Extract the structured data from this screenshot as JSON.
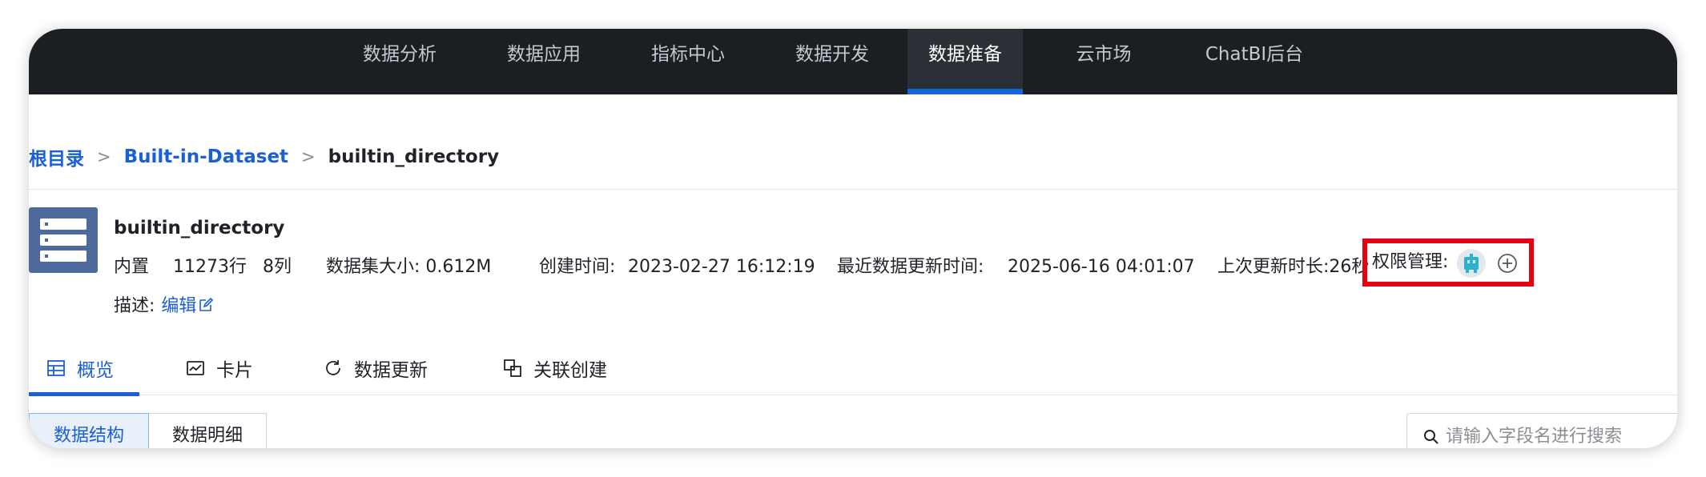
{
  "nav": {
    "items": [
      "数据分析",
      "数据应用",
      "指标中心",
      "数据开发",
      "数据准备",
      "云市场",
      "ChatBI后台"
    ],
    "active_index": 4
  },
  "breadcrumb": {
    "root": "根目录",
    "parent": "Built-in-Dataset",
    "current": "builtin_directory",
    "separator": ">"
  },
  "dataset": {
    "name": "builtin_directory",
    "type": "内置",
    "rows": "11273行",
    "columns": "8列",
    "size": "数据集大小: 0.612M",
    "created_label": "创建时间:",
    "created_value": "2023-02-27 16:12:19",
    "updated_label": "最近数据更新时间:",
    "updated_value": "2025-06-16 04:01:07",
    "last_update_duration": "上次更新时长:26秒",
    "permission_label": "权限管理:",
    "description_label": "描述:",
    "edit_label": "编辑"
  },
  "tabs": [
    {
      "label": "概览",
      "icon": "table-icon"
    },
    {
      "label": "卡片",
      "icon": "chart-card-icon"
    },
    {
      "label": "数据更新",
      "icon": "refresh-icon"
    },
    {
      "label": "关联创建",
      "icon": "link-create-icon"
    }
  ],
  "view_toggle": {
    "structure": "数据结构",
    "detail": "数据明细"
  },
  "search": {
    "placeholder": "请输入字段名进行搜索"
  },
  "colors": {
    "nav_bg": "#1b1f24",
    "accent": "#1a5fd4",
    "highlight": "#e60012",
    "dataset_icon": "#4e6a9c"
  }
}
